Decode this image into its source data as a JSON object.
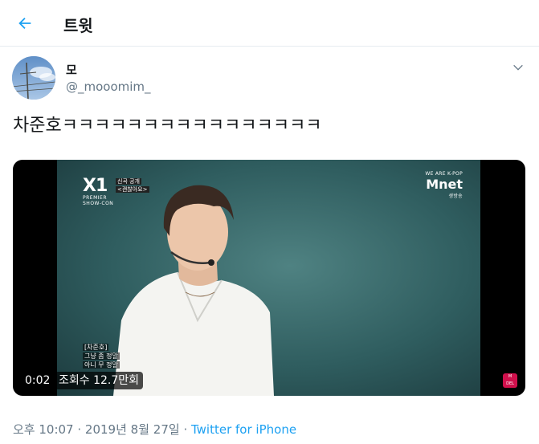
{
  "header": {
    "title": "트윗",
    "back_icon": "arrow-left-icon",
    "accent": "#1da1f2"
  },
  "author": {
    "name": "모",
    "handle": "@_mooomim_"
  },
  "tweet": {
    "text": "차준호ㅋㅋㅋㅋㅋㅋㅋㅋㅋㅋㅋㅋㅋㅋㅋㅋ"
  },
  "video": {
    "duration": "0:02",
    "views": "조회수 12.7만회",
    "logo_main": "X1",
    "logo_sub1": "PREMIER",
    "logo_sub2": "SHOW-CON",
    "song_tag_1": "신곡 공개",
    "song_tag_2": "<괜찮아요>",
    "mnet_top": "WE ARE K-POP",
    "mnet_brand": "Mnet",
    "mnet_bottom": "생방송",
    "subtitles": [
      "[차준호]",
      "그냥 좀 정말",
      "아니 무 정말"
    ]
  },
  "meta": {
    "time": "오후 10:07",
    "sep1": " · ",
    "date": "2019년 8월 27일",
    "sep2": " · ",
    "source": "Twitter for iPhone"
  }
}
